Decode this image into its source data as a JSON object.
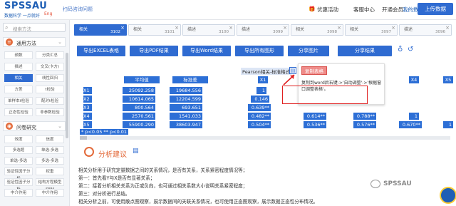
{
  "header": {
    "logo_text": "SPSSAU",
    "logo_sub": "数据科学 一点就好",
    "logo_tag": "Eng",
    "scan_text": "扫码咨询问题",
    "nav": [
      "优惠活动",
      "客服中心",
      "开通会员",
      "我的数据"
    ],
    "upload_label": "上传数据"
  },
  "sidebar": {
    "search_placeholder": "搜索方法",
    "common_label": "通用方法",
    "common_items": [
      "频数",
      "分类汇总",
      "描述",
      "交叉(卡方)",
      "相关",
      "线性回归",
      "方差",
      "t检验",
      "单样本t检验",
      "配对t检验",
      "正态性检验",
      "非参数检验"
    ],
    "questionnaire_label": "问卷研究",
    "questionnaire_items": [
      "效度",
      "信度",
      "多选题",
      "单选-多选",
      "单选-多选",
      "多选-多选",
      "验证性因子分析",
      "权重",
      "验证性因子分析",
      "结构方程模型SEM",
      "中介作用",
      "中介作用"
    ]
  },
  "tabs": [
    {
      "name": "相关",
      "no": "3102"
    },
    {
      "name": "相关",
      "no": "3101"
    },
    {
      "name": "描述",
      "no": "3100"
    },
    {
      "name": "描述",
      "no": "3099"
    },
    {
      "name": "相关",
      "no": "3098"
    },
    {
      "name": "相关",
      "no": "3097"
    },
    {
      "name": "描述",
      "no": "3096"
    }
  ],
  "actions": [
    "导出EXCEL表格",
    "导出PDF结果",
    "导出Word结果",
    "导出所有图形",
    "分享图片",
    "分享结果"
  ],
  "table": {
    "title": "Pearson相关-标准格式",
    "headers": [
      "平均值",
      "标准差",
      "X1",
      "X2",
      "X3",
      "X4",
      "X5"
    ],
    "rows": [
      {
        "label": "X1",
        "vals": [
          "25092.258",
          "19684.556",
          "1",
          "",
          "",
          "",
          ""
        ]
      },
      {
        "label": "X2",
        "vals": [
          "10614.065",
          "12204.599",
          "0.146",
          "",
          "",
          "",
          ""
        ]
      },
      {
        "label": "X3",
        "vals": [
          "800.564",
          "693.651",
          "0.639**",
          "",
          "",
          "",
          ""
        ]
      },
      {
        "label": "X4",
        "vals": [
          "2570.561",
          "1541.033",
          "0.482**",
          "0.614**",
          "0.788**",
          "1",
          ""
        ]
      },
      {
        "label": "X5",
        "vals": [
          "55900.290",
          "38603.947",
          "0.504**",
          "0.536**",
          "0.576**",
          "0.670**",
          "1"
        ]
      }
    ],
    "note": "* p<0.05 ** p<0.01"
  },
  "popup": {
    "button": "复制表格",
    "text": "复制到word后右键->'自动调整'->'根据窗口调整表格'。"
  },
  "analysis": {
    "title": "分析建议",
    "lines": [
      "相关分析用于研究定量数据之间的关系情况，是否有关系，关系紧密程度情况等；",
      "第一：首先看Y与X是否有显著关系；",
      "第二：接着分析相关关系为正或负向，也可通过相关系数大小说明关系紧密程度；",
      "第三：对分析进行总结。",
      "相关分析之前，可使用散点图观察，展示数据间的关联关系情况，也可使用正态图观察，展示数据正态性分布情况。"
    ]
  },
  "watermark": "SPSSAU"
}
